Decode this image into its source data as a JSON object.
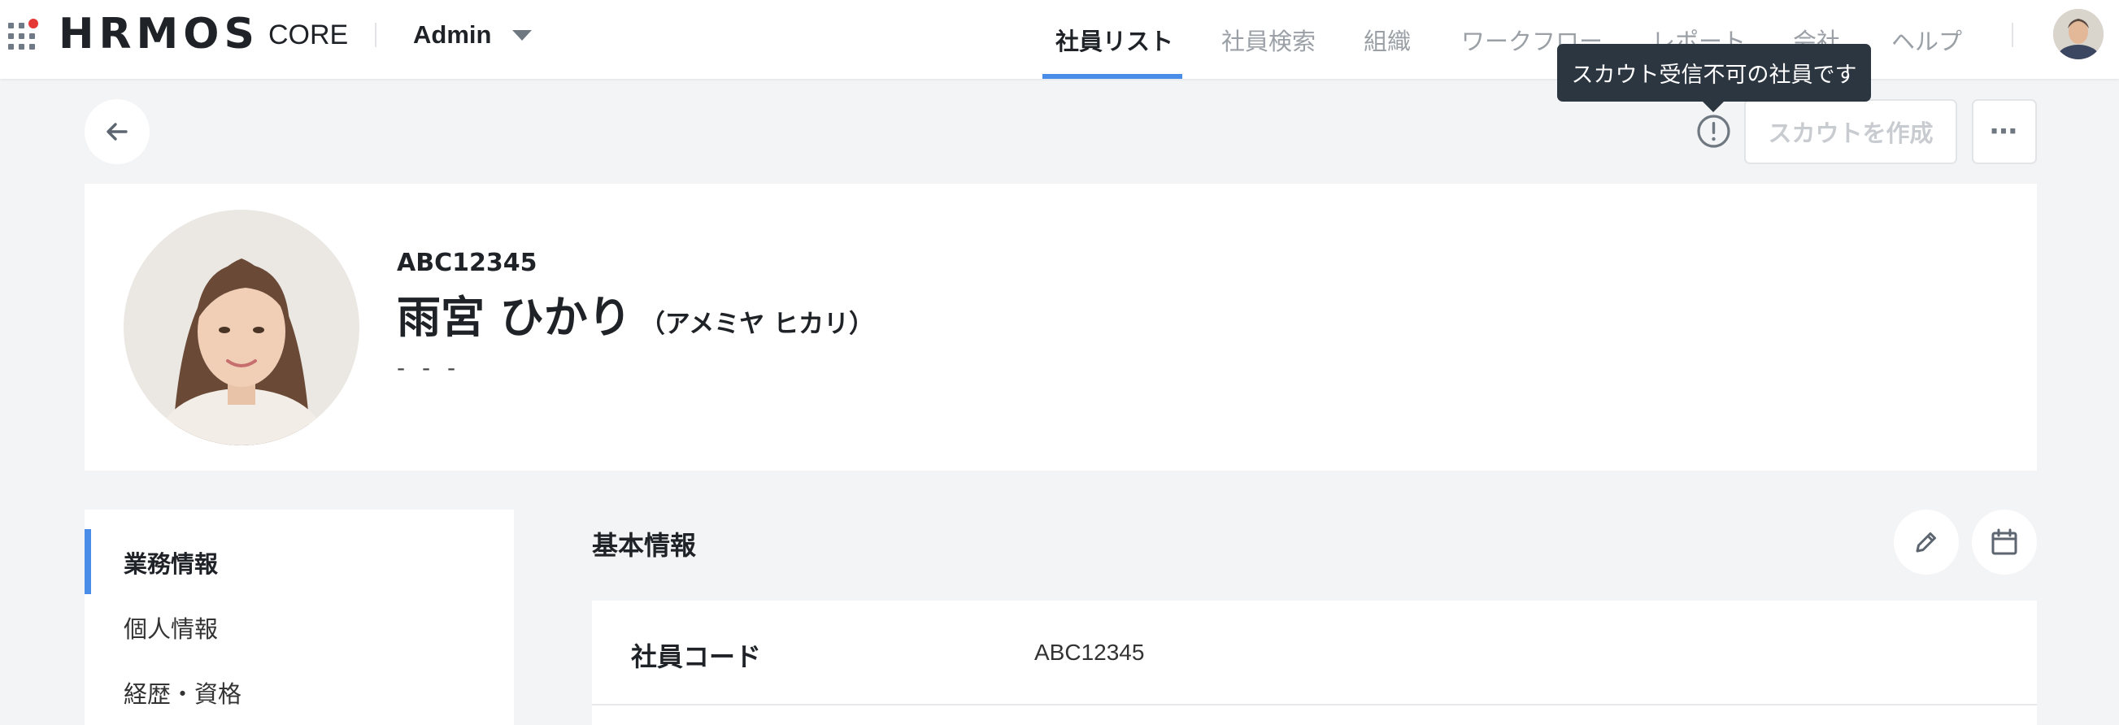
{
  "header": {
    "logo": "HRMOS",
    "product": "CORE",
    "workspace": "Admin",
    "nav": [
      {
        "label": "社員リスト",
        "active": true
      },
      {
        "label": "社員検索",
        "active": false
      },
      {
        "label": "組織",
        "active": false
      },
      {
        "label": "ワークフロー",
        "active": false
      },
      {
        "label": "レポート",
        "active": false
      },
      {
        "label": "会社",
        "active": false
      },
      {
        "label": "ヘルプ",
        "active": false
      }
    ],
    "accent": "#4a8de8"
  },
  "tooltip": "スカウト受信不可の社員です",
  "actions": {
    "scout_button": "スカウトを作成",
    "more_button": "⋯"
  },
  "profile": {
    "employee_id": "ABC12345",
    "name": "雨宮 ひかり",
    "kana": "（アメミヤ ヒカリ）",
    "sub": "- - -"
  },
  "sidebar": {
    "items": [
      {
        "label": "業務情報",
        "active": true
      },
      {
        "label": "個人情報",
        "active": false
      },
      {
        "label": "経歴・資格",
        "active": false
      }
    ]
  },
  "section": {
    "title": "基本情報",
    "rows": [
      {
        "label": "社員コード",
        "value": "ABC12345"
      }
    ]
  }
}
